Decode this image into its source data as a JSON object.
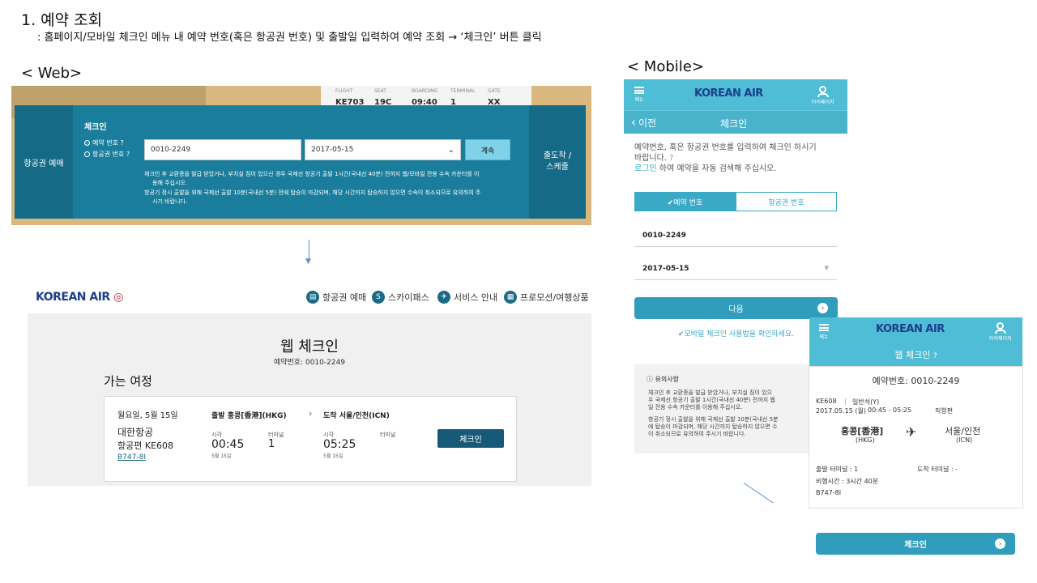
{
  "header": {
    "title": "1.   예약 조회",
    "subtitle": ": 홈페이지/모바일 체크인 메뉴 내 예약 번호(혹은 항공권 번호) 및 출발일 입력하여 예약 조회 → ‘체크인’ 버튼 클릭"
  },
  "sections": {
    "web": "< Web>",
    "mobile": "< Mobile>"
  },
  "web_widget": {
    "boarding_card": [
      {
        "label": "FLIGHT",
        "value": "KE703"
      },
      {
        "label": "SEAT",
        "value": "19C"
      },
      {
        "label": "BOARDING",
        "value": "09:40"
      },
      {
        "label": "TERMINAL",
        "value": "1"
      },
      {
        "label": "GATE",
        "value": "XX"
      }
    ],
    "left_tab": "항공권 예매",
    "right_tab_line1": "출도착 /",
    "right_tab_line2": "스케줄",
    "panel_title": "체크인",
    "radio_booking": "예약 번호 ?",
    "radio_ticket": "항공권 번호 ?",
    "booking_value": "0010-2249",
    "date_value": "2017-05-15",
    "next_label": "계속",
    "note1_a": "체크인 후 교환증을 발급 받았거나, 부치실 짐이 있으신 경우 국제선 항공기 출발 1시간(국내선 40분) 전까지 웹/모바일 전용 수속 카운터를 이",
    "note1_b": "용해 주십시오.",
    "note2_a": "항공기 정시 출발을 위해 국제선 출발 10분(국내선 5분) 전에 탑승이 마감되며, 해당 시간까지 탑승하지 않으면 수속이 취소되므로 유의하여 주",
    "note2_b": "시기 바랍니다."
  },
  "web_result": {
    "logo": "KOREAN AIR",
    "nav": [
      {
        "label": "항공권 예매",
        "icon": "ticket-icon"
      },
      {
        "label": "스카이패스",
        "icon": "skypass-icon"
      },
      {
        "label": "서비스 안내",
        "icon": "plane-icon"
      },
      {
        "label": "프로모션/여행상품",
        "icon": "promotion-icon"
      }
    ],
    "page_title": "웹 체크인",
    "booking_no": "예약번호: 0010-2249",
    "trip_heading": "가는 여정",
    "date": "월요일, 5월 15일",
    "airline": "대한항공",
    "flight": "항공편 KE608",
    "aircraft": "B747-8I",
    "depart": "출발 홍콩[香港](HKG)",
    "arrive": "도착 서울/인천(ICN)",
    "time_label": "시각",
    "terminal_label": "터미널",
    "dep_time": "00:45",
    "dep_terminal": "1",
    "dep_date": "5월 15일",
    "arr_time": "05:25",
    "arr_date": "5월 15일",
    "checkin": "체크인"
  },
  "mobile1": {
    "menu": "메뉴",
    "logo": "KOREAN AIR",
    "mypage": "마이페이지",
    "back": "이전",
    "title": "체크인",
    "desc1": "예약번호, 혹은 항공권 번호를 입력하여 체크인 하시기",
    "desc2": "바랍니다.",
    "desc3_link": "로그인",
    "desc3": " 하여 예약을 자동 검색해 주십시오.",
    "tab_booking": "✔예약 번호",
    "tab_ticket": "항공권 번호",
    "booking_value": "0010-2249",
    "date_value": "2017-05-15",
    "next": "다음",
    "howto": "✔모바일 체크인 사용법을 확인하세요.",
    "notice_title": "유의사항",
    "note1": "체크인 후 교환증을 발급 받았거나, 부치실 짐이 있으",
    "note1b": "우 국제선 항공기 출발 1시간(국내선 40분) 전까지 웹",
    "note1c": "일 전용 수속 카운터를 이용해 주십시오.",
    "note2": "항공기 정시 출발을 위해 국제선 출발 10분(국내선 5분",
    "note2b": "에 탑승이 마감되며, 해당 시간까지 탑승하지 않으면 수",
    "note2c": "이 취소되므로 유의하여 주시기 바랍니다."
  },
  "mobile2": {
    "menu": "메뉴",
    "logo": "KOREAN AIR",
    "mypage": "마이페이지",
    "title": "웹 체크인",
    "booking_no": "예약번호: 0010-2249",
    "flight": "KE608",
    "class": "일반석(Y)",
    "date": "2017.05.15 (월)",
    "time": "00:45 - 05:25",
    "route_type": "직항편",
    "dep_city": "홍콩[香港]",
    "dep_code": "(HKG)",
    "arr_city": "서울/인천",
    "arr_code": "(ICN)",
    "dep_terminal": "출발 터미널 : 1",
    "arr_terminal": "도착 터미널 : -",
    "duration": "비행시간 : 3시간 40분",
    "aircraft": "B747-8I",
    "checkin": "체크인"
  },
  "colors": {
    "panel": "#1b7d9c",
    "mobile_header": "#4fbdd6",
    "button": "#2f9dbb",
    "brand_blue": "#1d3f8a",
    "brand_red": "#c0273a"
  }
}
